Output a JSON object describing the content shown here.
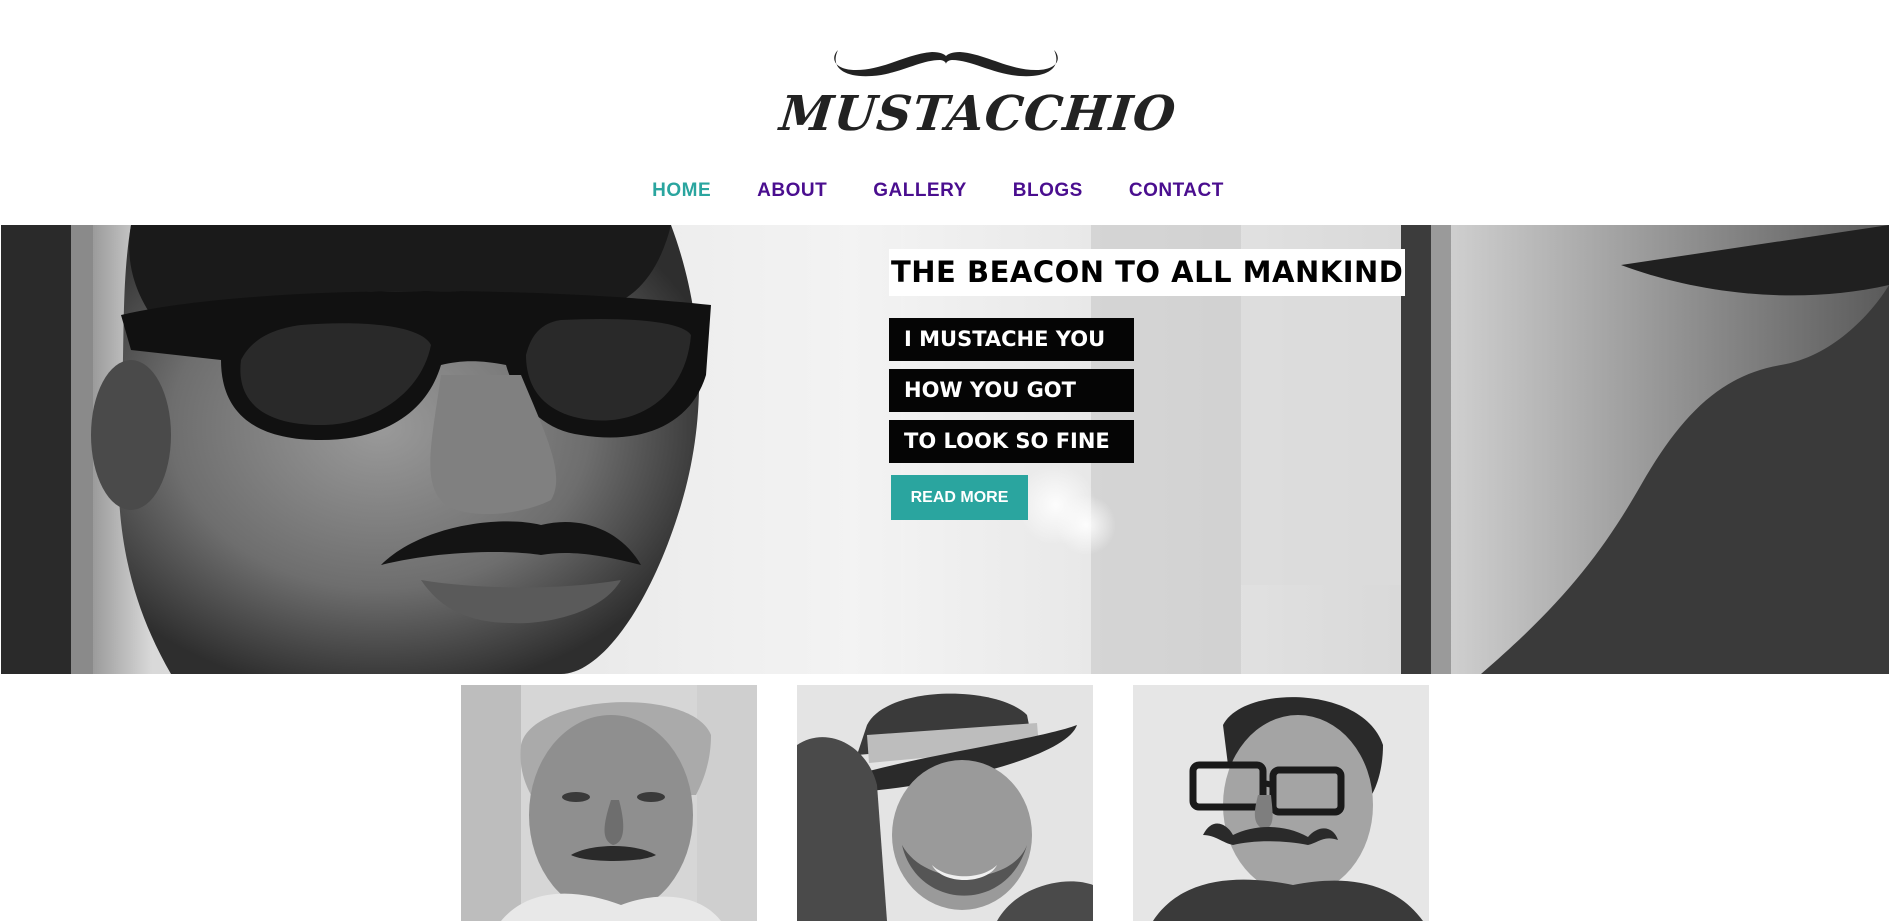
{
  "brand": {
    "logo_text": "MUSTACCHIO"
  },
  "nav": {
    "items": [
      {
        "label": "HOME",
        "active": true
      },
      {
        "label": "ABOUT",
        "active": false
      },
      {
        "label": "GALLERY",
        "active": false
      },
      {
        "label": "BLOGS",
        "active": false
      },
      {
        "label": "CONTACT",
        "active": false
      }
    ]
  },
  "hero": {
    "headline": "THE BEACON TO ALL MANKIND",
    "taglines": [
      "I MUSTACHE YOU",
      "HOW YOU GOT",
      "TO LOOK SO FINE"
    ],
    "cta_label": "READ MORE"
  },
  "colors": {
    "nav_text": "#4a0e8f",
    "nav_active": "#2aa59f",
    "button_bg": "#2aa59f",
    "tagline_bg": "#050505"
  },
  "icons": [
    "mustache-icon"
  ]
}
